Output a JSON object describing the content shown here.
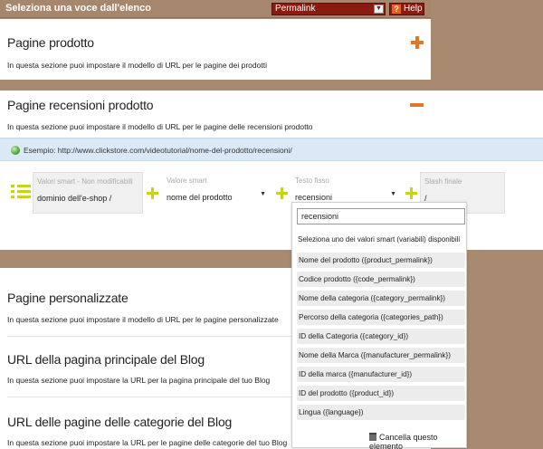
{
  "topbar": {
    "title": "Seleziona una voce dall'elenco",
    "select_value": "Permalink",
    "help_label": "Help"
  },
  "sections": {
    "product": {
      "title": "Pagine prodotto",
      "description": "In questa sezione puoi impostare il modello di URL per le pagine dei prodotti"
    },
    "reviews": {
      "title": "Pagine recensioni prodotto",
      "description": "In questa sezione puoi impostare il modello di URL per le pagine delle recensioni prodotto",
      "example": "Esempio: http://www.clickstore.com/videotutorial/nome-del-prodotto/recensioni/",
      "fields": [
        {
          "label": "Valori smart - Non modificabili",
          "value": "dominio dell'e-shop /"
        },
        {
          "label": "Valore smart",
          "value": "nome del prodotto"
        },
        {
          "label": "Testo fisso",
          "value": "recensioni"
        },
        {
          "label": "Slash finale",
          "value": "/"
        }
      ]
    },
    "custom": {
      "title": "Pagine personalizzate",
      "description": "In questa sezione puoi impostare il modello di URL per le pagine personalizzate"
    },
    "blog_main": {
      "title": "URL della pagina principale del Blog",
      "description": "In questa sezione puoi impostare la URL per la pagina principale del tuo Blog"
    },
    "blog_categories": {
      "title": "URL delle pagine delle categorie del Blog",
      "description": "In questa sezione puoi impostare la URL per le pagine delle categorie del tuo Blog"
    }
  },
  "dropdown": {
    "search_value": "recensioni",
    "header": "Seleziona uno dei valori smart (variabili) disponibili",
    "items": [
      "Nome del prodotto ({product_permalink})",
      "Codice prodotto ({code_permalink})",
      "Nome della categoria ({category_permalink})",
      "Percorso della categoria ({categories_path})",
      "ID della Categoria ({category_id})",
      "Nome della Marca ({manufacturer_permalink})",
      "ID della marca ({manufacturer_id})",
      "ID del prodotto ({product_id})",
      "Lingua ({language})"
    ],
    "delete_label": "Cancella questo elemento"
  },
  "colors": {
    "accent_orange": "#e0782c",
    "accent_green": "#c6d21e",
    "topbar": "#a6876d",
    "button_red": "#8b1a10"
  }
}
